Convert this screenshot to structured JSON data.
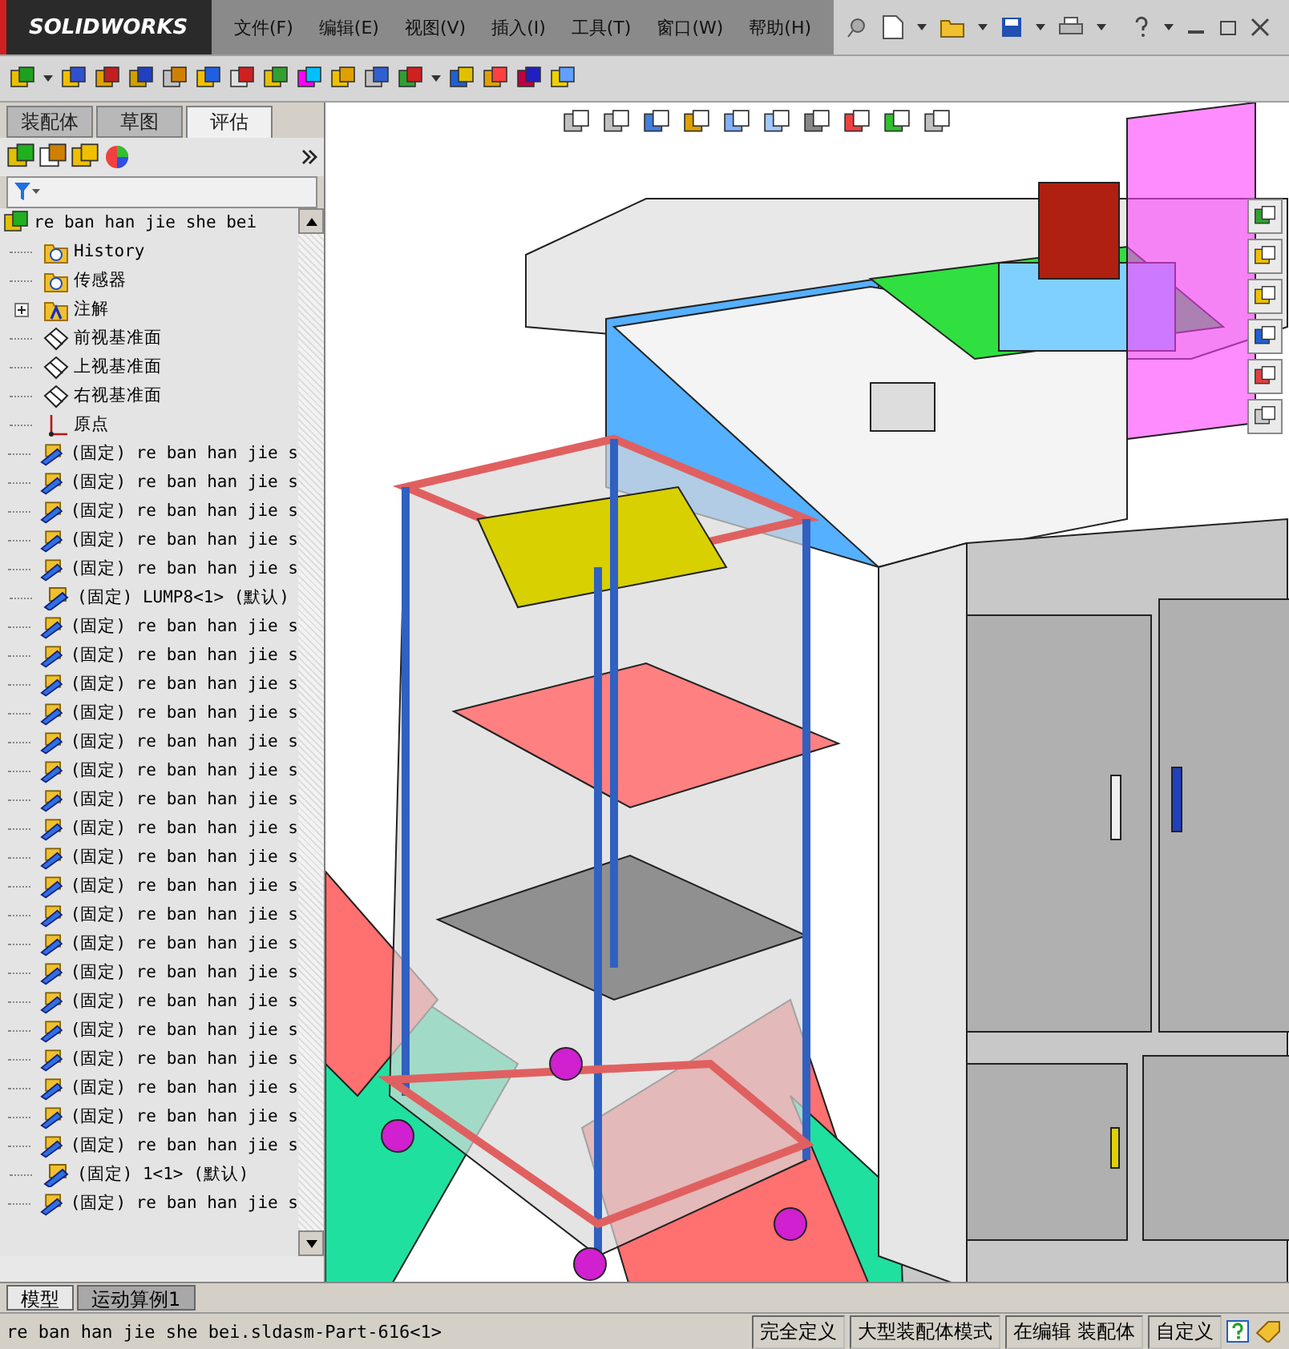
{
  "app": {
    "logo": "SOLIDWORKS"
  },
  "menu": [
    "文件(F)",
    "编辑(E)",
    "视图(V)",
    "插入(I)",
    "工具(T)",
    "窗口(W)",
    "帮助(H)"
  ],
  "panel_tabs": [
    {
      "label": "装配体",
      "selected": false
    },
    {
      "label": "草图",
      "selected": false
    },
    {
      "label": "评估",
      "selected": true
    }
  ],
  "tree": {
    "root": "re ban han jie she bei",
    "items": [
      {
        "kind": "folder",
        "label": "History",
        "expandable": false
      },
      {
        "kind": "folder",
        "label": "传感器",
        "expandable": false
      },
      {
        "kind": "note",
        "label": "注解",
        "expandable": true
      },
      {
        "kind": "plane",
        "label": "前视基准面",
        "expandable": false
      },
      {
        "kind": "plane",
        "label": "上视基准面",
        "expandable": false
      },
      {
        "kind": "plane",
        "label": "右视基准面",
        "expandable": false
      },
      {
        "kind": "origin",
        "label": "原点",
        "expandable": false
      },
      {
        "kind": "part",
        "label": "(固定) re ban han jie s",
        "expandable": false
      },
      {
        "kind": "part",
        "label": "(固定) re ban han jie s",
        "expandable": false
      },
      {
        "kind": "part",
        "label": "(固定) re ban han jie s",
        "expandable": false
      },
      {
        "kind": "part",
        "label": "(固定) re ban han jie s",
        "expandable": false
      },
      {
        "kind": "part",
        "label": "(固定) re ban han jie s",
        "expandable": false
      },
      {
        "kind": "part",
        "label": "(固定) LUMP8<1> (默认)",
        "expandable": false
      },
      {
        "kind": "part",
        "label": "(固定) re ban han jie s",
        "expandable": false
      },
      {
        "kind": "part",
        "label": "(固定) re ban han jie s",
        "expandable": false
      },
      {
        "kind": "part",
        "label": "(固定) re ban han jie s",
        "expandable": false
      },
      {
        "kind": "part",
        "label": "(固定) re ban han jie s",
        "expandable": false
      },
      {
        "kind": "part",
        "label": "(固定) re ban han jie s",
        "expandable": false
      },
      {
        "kind": "part",
        "label": "(固定) re ban han jie s",
        "expandable": false
      },
      {
        "kind": "part",
        "label": "(固定) re ban han jie s",
        "expandable": false
      },
      {
        "kind": "part",
        "label": "(固定) re ban han jie s",
        "expandable": false
      },
      {
        "kind": "part",
        "label": "(固定) re ban han jie s",
        "expandable": false
      },
      {
        "kind": "part",
        "label": "(固定) re ban han jie s",
        "expandable": false
      },
      {
        "kind": "part",
        "label": "(固定) re ban han jie s",
        "expandable": false
      },
      {
        "kind": "part",
        "label": "(固定) re ban han jie s",
        "expandable": false
      },
      {
        "kind": "part",
        "label": "(固定) re ban han jie s",
        "expandable": false
      },
      {
        "kind": "part",
        "label": "(固定) re ban han jie s",
        "expandable": false
      },
      {
        "kind": "part",
        "label": "(固定) re ban han jie s",
        "expandable": false
      },
      {
        "kind": "part",
        "label": "(固定) re ban han jie s",
        "expandable": false
      },
      {
        "kind": "part",
        "label": "(固定) re ban han jie s",
        "expandable": false
      },
      {
        "kind": "part",
        "label": "(固定) re ban han jie s",
        "expandable": false
      },
      {
        "kind": "part",
        "label": "(固定) re ban han jie s",
        "expandable": false
      },
      {
        "kind": "part",
        "label": "(固定) 1<1> (默认)",
        "expandable": false
      },
      {
        "kind": "part",
        "label": "(固定) re ban han jie s",
        "expandable": false
      }
    ]
  },
  "bottom_tabs": [
    {
      "label": "模型",
      "selected": true
    },
    {
      "label": "运动算例1",
      "selected": false
    }
  ],
  "status_bar": [
    "re ban han jie she bei.sldasm-Part-616<1>",
    "完全定义",
    "大型装配体模式",
    "在编辑 装配体",
    "自定义"
  ]
}
